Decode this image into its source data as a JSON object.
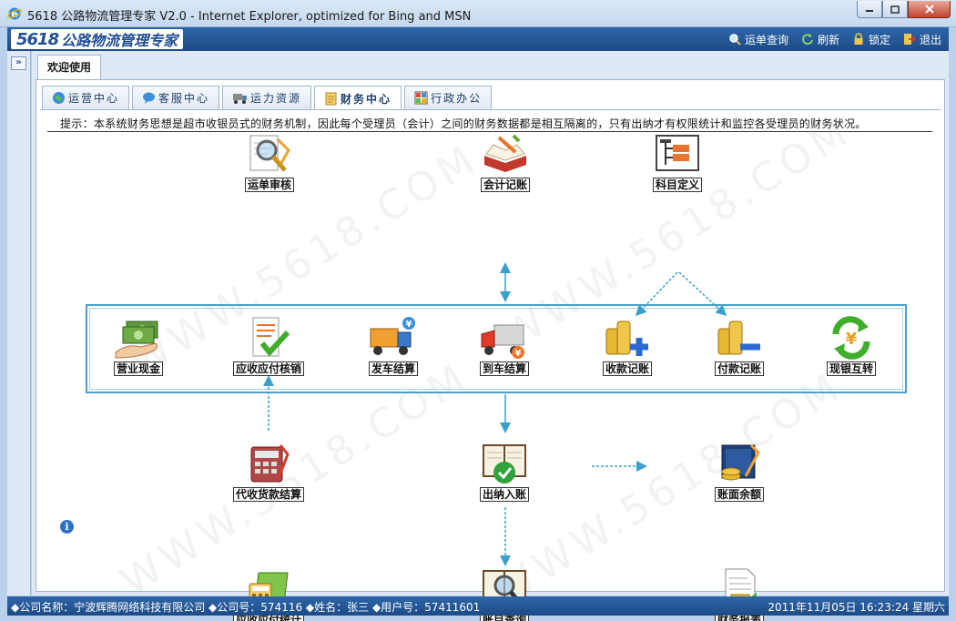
{
  "window": {
    "title": "5618 公路物流管理专家 V2.0 - Internet Explorer, optimized for Bing and MSN"
  },
  "header": {
    "logo_number": "5618",
    "logo_name": "公路物流管理专家",
    "actions": [
      {
        "label": "运单查询",
        "icon": "search-icon"
      },
      {
        "label": "刷新",
        "icon": "refresh-icon"
      },
      {
        "label": "锁定",
        "icon": "lock-icon"
      },
      {
        "label": "退出",
        "icon": "exit-icon"
      }
    ]
  },
  "sidebar": {
    "collapse_label": "»"
  },
  "top_tab": {
    "label": "欢迎使用"
  },
  "subtabs": [
    {
      "label": "运营中心",
      "icon": "globe-icon",
      "active": false
    },
    {
      "label": "客服中心",
      "icon": "chat-icon",
      "active": false
    },
    {
      "label": "运力资源",
      "icon": "truck-icon",
      "active": false
    },
    {
      "label": "财务中心",
      "icon": "finance-icon",
      "active": true
    },
    {
      "label": "行政办公",
      "icon": "grid-icon",
      "active": false
    }
  ],
  "notice": "提示：本系统财务思想是超市收银员式的财务机制，因此每个受理员（会计）之间的财务数据都是相互隔离的，只有出纳才有权限统计和监控各受理员的财务状况。",
  "watermark": "WWW.5618.COM",
  "functions": {
    "waybill_audit": "运单审核",
    "accounting": "会计记账",
    "subject_def": "科目定义",
    "business_cash": "营业现金",
    "ar_ap_writeoff": "应收应付核销",
    "dispatch_settle": "发车结算",
    "arrival_settle": "到车结算",
    "receipt_record": "收款记账",
    "payment_record": "付款记账",
    "cash_bank_transfer": "现银互转",
    "cod_settle": "代收货款结算",
    "cashier_entry": "出纳入账",
    "book_balance": "账面余额",
    "ar_ap_stats": "应收应付统计",
    "account_query": "账目查询",
    "finance_report": "财务报表"
  },
  "statusbar": {
    "left": "◆公司名称：宁波辉腾网络科技有限公司 ◆公司号：574116 ◆姓名：张三 ◆用户号：57411601",
    "right": "2011年11月05日 16:23:24 星期六"
  },
  "colors": {
    "header_blue": "#1c4b86",
    "flow_arrow": "#3a9fcb",
    "group_border": "#4aa0c8"
  }
}
